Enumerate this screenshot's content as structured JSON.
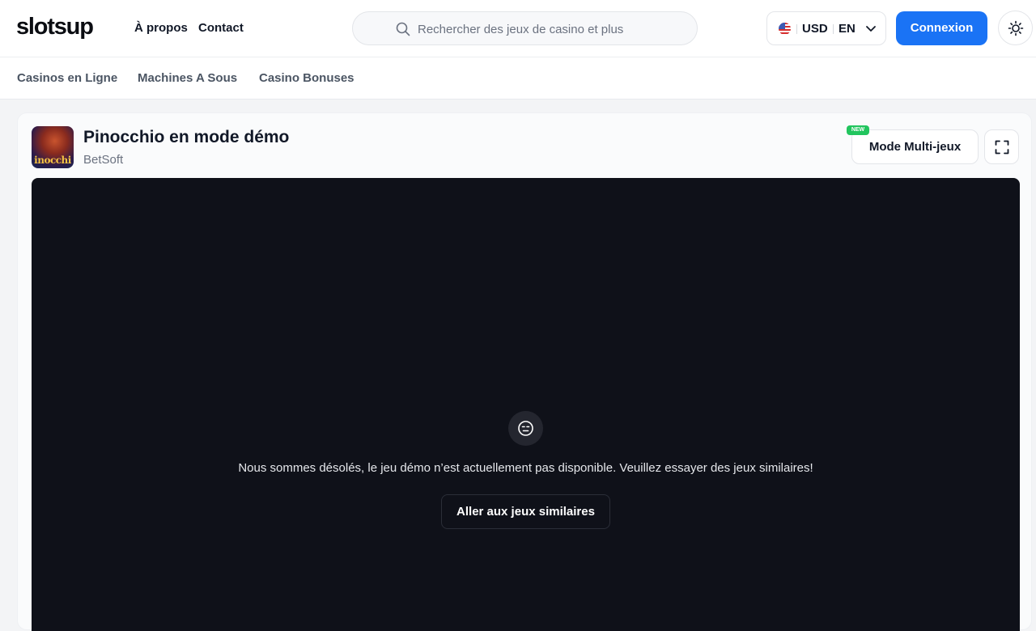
{
  "header": {
    "logo": "slotsup",
    "nav": [
      "À propos",
      "Contact"
    ],
    "search_placeholder": "Rechercher des jeux de casino et plus",
    "currency": "USD",
    "language": "EN",
    "login_label": "Connexion"
  },
  "subnav": [
    "Casinos en Ligne",
    "Machines A Sous",
    "Casino Bonuses"
  ],
  "game": {
    "thumb_text": "inocchi",
    "title": "Pinocchio en mode démo",
    "provider": "BetSoft",
    "new_badge": "NEW",
    "multi_mode_label": "Mode Multi-jeux",
    "unavailable_message": "Nous sommes désolés, le jeu démo n’est actuellement pas disponible. Veuillez essayer des jeux similaires!",
    "similar_button_label": "Aller aux jeux similaires"
  },
  "colors": {
    "primary": "#1a73f5",
    "badge": "#22c55e",
    "game_bg": "#0f1119"
  }
}
